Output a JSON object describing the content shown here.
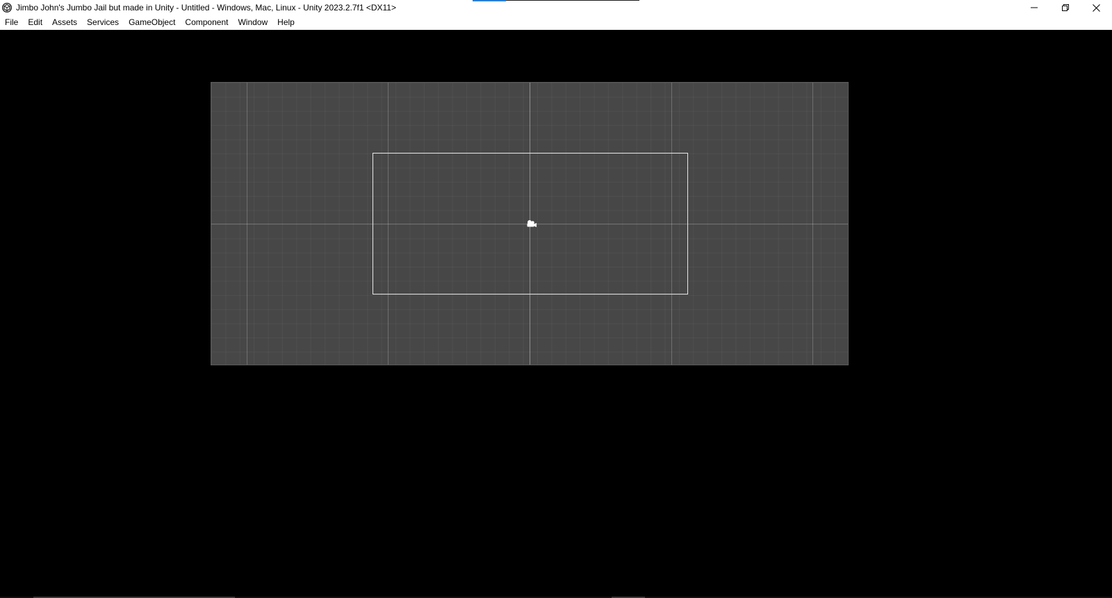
{
  "window": {
    "title": "Jimbo John's Jumbo Jail but made in Unity - Untitled - Windows, Mac, Linux - Unity 2023.2.7f1 <DX11>",
    "app_icon": "unity-logo-icon",
    "controls": {
      "minimize_icon": "minimize-icon",
      "restore_icon": "restore-icon",
      "close_icon": "close-icon"
    }
  },
  "menubar": {
    "items": [
      {
        "label": "File"
      },
      {
        "label": "Edit"
      },
      {
        "label": "Assets"
      },
      {
        "label": "Services"
      },
      {
        "label": "GameObject"
      },
      {
        "label": "Component"
      },
      {
        "label": "Window"
      },
      {
        "label": "Help"
      }
    ]
  },
  "scene": {
    "background_color": "#474747",
    "grid_line_color": "#6a6a6a",
    "camera_frame_color": "#e8e8e8",
    "camera_icon": "camera-gizmo-icon"
  },
  "colors": {
    "titlebar_bg": "#ffffff",
    "viewport_bg": "#000000",
    "accent": "#2a7fd6"
  }
}
